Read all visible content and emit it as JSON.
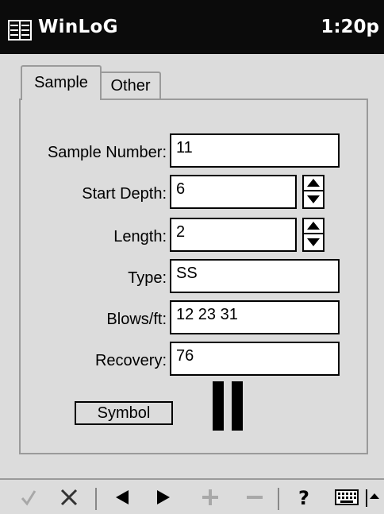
{
  "header": {
    "app_title": "WinLoG",
    "time": "1:20p"
  },
  "tabs": [
    {
      "label": "Sample",
      "active": true
    },
    {
      "label": "Other",
      "active": false
    }
  ],
  "form": {
    "sample_number": {
      "label": "Sample Number:",
      "value": "11"
    },
    "start_depth": {
      "label": "Start Depth:",
      "value": "6"
    },
    "length": {
      "label": "Length:",
      "value": "2"
    },
    "type": {
      "label": "Type:",
      "value": "SS"
    },
    "blows_ft": {
      "label": "Blows/ft:",
      "value": "12 23 31"
    },
    "recovery": {
      "label": "Recovery:",
      "value": "76"
    },
    "symbol_button": "Symbol"
  },
  "toolbar": {
    "icons": [
      "check-icon",
      "close-icon",
      "prev-icon",
      "next-icon",
      "plus-icon",
      "minus-icon",
      "help-icon",
      "keyboard-icon",
      "sip-arrow-icon"
    ],
    "help_label": "?"
  }
}
